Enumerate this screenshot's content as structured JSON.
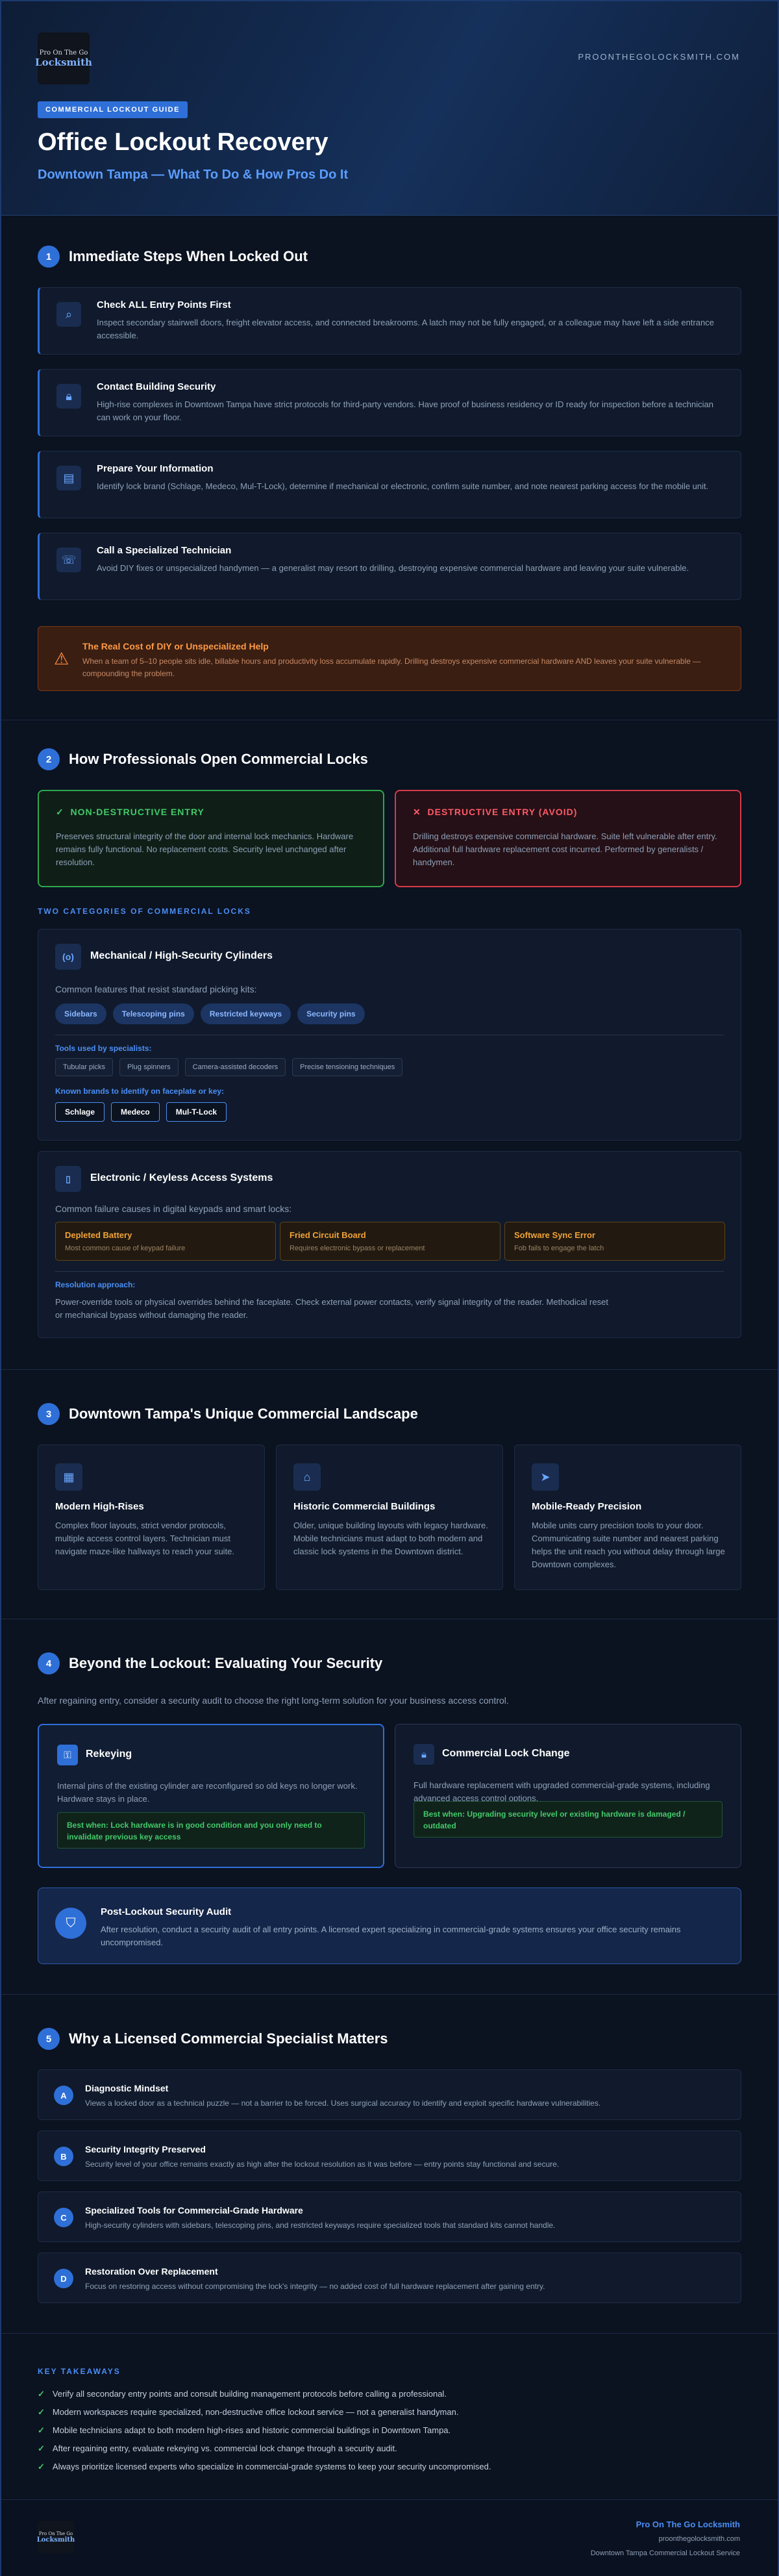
{
  "header": {
    "logo_line1": "Pro On The Go",
    "logo_line2": "Locksmith",
    "site": "PROONTHEGOLOCKSMITH.COM",
    "tag": "COMMERCIAL LOCKOUT GUIDE",
    "title": "Office Lockout Recovery",
    "subtitle": "Downtown Tampa — What To Do & How Pros Do It"
  },
  "section1": {
    "num": "1",
    "title": "Immediate Steps When Locked Out",
    "steps": [
      {
        "icon": "search-icon",
        "title": "Check ALL Entry Points First",
        "desc": "Inspect secondary stairwell doors, freight elevator access, and connected breakrooms. A latch may not be fully engaged, or a colleague may have left a side entrance accessible."
      },
      {
        "icon": "lock-icon",
        "title": "Contact Building Security",
        "desc": "High-rise complexes in Downtown Tampa have strict protocols for third-party vendors. Have proof of business residency or ID ready for inspection before a technician can work on your floor."
      },
      {
        "icon": "document-icon",
        "title": "Prepare Your Information",
        "desc": "Identify lock brand (Schlage, Medeco, Mul-T-Lock), determine if mechanical or electronic, confirm suite number, and note nearest parking access for the mobile unit."
      },
      {
        "icon": "phone-icon",
        "title": "Call a Specialized Technician",
        "desc": "Avoid DIY fixes or unspecialized handymen — a generalist may resort to drilling, destroying expensive commercial hardware and leaving your suite vulnerable."
      }
    ],
    "warning": {
      "title": "The Real Cost of DIY or Unspecialized Help",
      "desc": "When a team of 5–10 people sits idle, billable hours and productivity loss accumulate rapidly. Drilling destroys expensive commercial hardware AND leaves your suite vulnerable — compounding the problem."
    }
  },
  "section2": {
    "num": "2",
    "title": "How Professionals Open Commercial Locks",
    "nondestructive": {
      "title": "NON-DESTRUCTIVE ENTRY",
      "desc": "Preserves structural integrity of the door and internal lock mechanics. Hardware remains fully functional. No replacement costs. Security level unchanged after resolution."
    },
    "destructive": {
      "title": "DESTRUCTIVE ENTRY (AVOID)",
      "desc": "Drilling destroys expensive commercial hardware. Suite left vulnerable after entry. Additional full hardware replacement cost incurred. Performed by generalists / handymen."
    },
    "categories_label": "TWO CATEGORIES OF COMMERCIAL LOCKS",
    "mechanical": {
      "title": "Mechanical / High-Security Cylinders",
      "lead": "Common features that resist standard picking kits:",
      "features": [
        "Sidebars",
        "Telescoping pins",
        "Restricted keyways",
        "Security pins"
      ],
      "tools_label": "Tools used by specialists:",
      "tools": [
        "Tubular picks",
        "Plug spinners",
        "Camera-assisted decoders",
        "Precise tensioning techniques"
      ],
      "brands_label": "Known brands to identify on faceplate or key:",
      "brands": [
        "Schlage",
        "Medeco",
        "Mul-T-Lock"
      ]
    },
    "electronic": {
      "title": "Electronic / Keyless Access Systems",
      "lead": "Common failure causes in digital keypads and smart locks:",
      "failures": [
        {
          "title": "Depleted Battery",
          "desc": "Most common cause of keypad failure"
        },
        {
          "title": "Fried Circuit Board",
          "desc": "Requires electronic bypass or replacement"
        },
        {
          "title": "Software Sync Error",
          "desc": "Fob fails to engage the latch"
        }
      ],
      "resolution_label": "Resolution approach:",
      "resolution": "Power-override tools or physical overrides behind the faceplate. Check external power contacts, verify signal integrity of the reader. Methodical reset or mechanical bypass without damaging the reader."
    }
  },
  "section3": {
    "num": "3",
    "title": "Downtown Tampa's Unique Commercial Landscape",
    "tiles": [
      {
        "title": "Modern High-Rises",
        "desc": "Complex floor layouts, strict vendor protocols, multiple access control layers. Technician must navigate maze-like hallways to reach your suite."
      },
      {
        "title": "Historic Commercial Buildings",
        "desc": "Older, unique building layouts with legacy hardware. Mobile technicians must adapt to both modern and classic lock systems in the Downtown district."
      },
      {
        "title": "Mobile-Ready Precision",
        "desc": "Mobile units carry precision tools to your door. Communicating suite number and nearest parking helps the unit reach you without delay through large Downtown complexes."
      }
    ]
  },
  "section4": {
    "num": "4",
    "title": "Beyond the Lockout: Evaluating Your Security",
    "lead": "After regaining entry, consider a security audit to choose the right long-term solution for your business access control.",
    "rekey": {
      "title": "Rekeying",
      "desc": "Internal pins of the existing cylinder are reconfigured so old keys no longer work. Hardware stays in place.",
      "best": "Best when: Lock hardware is in good condition and you only need to invalidate previous key access"
    },
    "change": {
      "title": "Commercial Lock Change",
      "desc": "Full hardware replacement with upgraded commercial-grade systems, including advanced access control options.",
      "best": "Best when: Upgrading security level or existing hardware is damaged / outdated"
    },
    "audit": {
      "title": "Post-Lockout Security Audit",
      "desc": "After resolution, conduct a security audit of all entry points. A licensed expert specializing in commercial-grade systems ensures your office security remains uncompromised."
    }
  },
  "section5": {
    "num": "5",
    "title": "Why a Licensed Commercial Specialist Matters",
    "reasons": [
      {
        "n": "A",
        "title": "Diagnostic Mindset",
        "desc": "Views a locked door as a technical puzzle — not a barrier to be forced. Uses surgical accuracy to identify and exploit specific hardware vulnerabilities."
      },
      {
        "n": "B",
        "title": "Security Integrity Preserved",
        "desc": "Security level of your office remains exactly as high after the lockout resolution as it was before — entry points stay functional and secure."
      },
      {
        "n": "C",
        "title": "Specialized Tools for Commercial-Grade Hardware",
        "desc": "High-security cylinders with sidebars, telescoping pins, and restricted keyways require specialized tools that standard kits cannot handle."
      },
      {
        "n": "D",
        "title": "Restoration Over Replacement",
        "desc": "Focus on restoring access without compromising the lock's integrity — no added cost of full hardware replacement after gaining entry."
      }
    ]
  },
  "takeaways": {
    "label": "KEY TAKEAWAYS",
    "items": [
      "Verify all secondary entry points and consult building management protocols before calling a professional.",
      "Modern workspaces require specialized, non-destructive office lockout service — not a generalist handyman.",
      "Mobile technicians adapt to both modern high-rises and historic commercial buildings in Downtown Tampa.",
      "After regaining entry, evaluate rekeying vs. commercial lock change through a security audit.",
      "Always prioritize licensed experts who specialize in commercial-grade systems to keep your security uncompromised."
    ]
  },
  "footer": {
    "brand": "Pro On The Go Locksmith",
    "site": "proonthegolocksmith.com",
    "service": "Downtown Tampa Commercial Lockout Service"
  },
  "colors": {
    "accent": "#2f6fd8",
    "green": "#2ea84d",
    "red": "#d83a4a",
    "orange": "#ff8a3d"
  }
}
